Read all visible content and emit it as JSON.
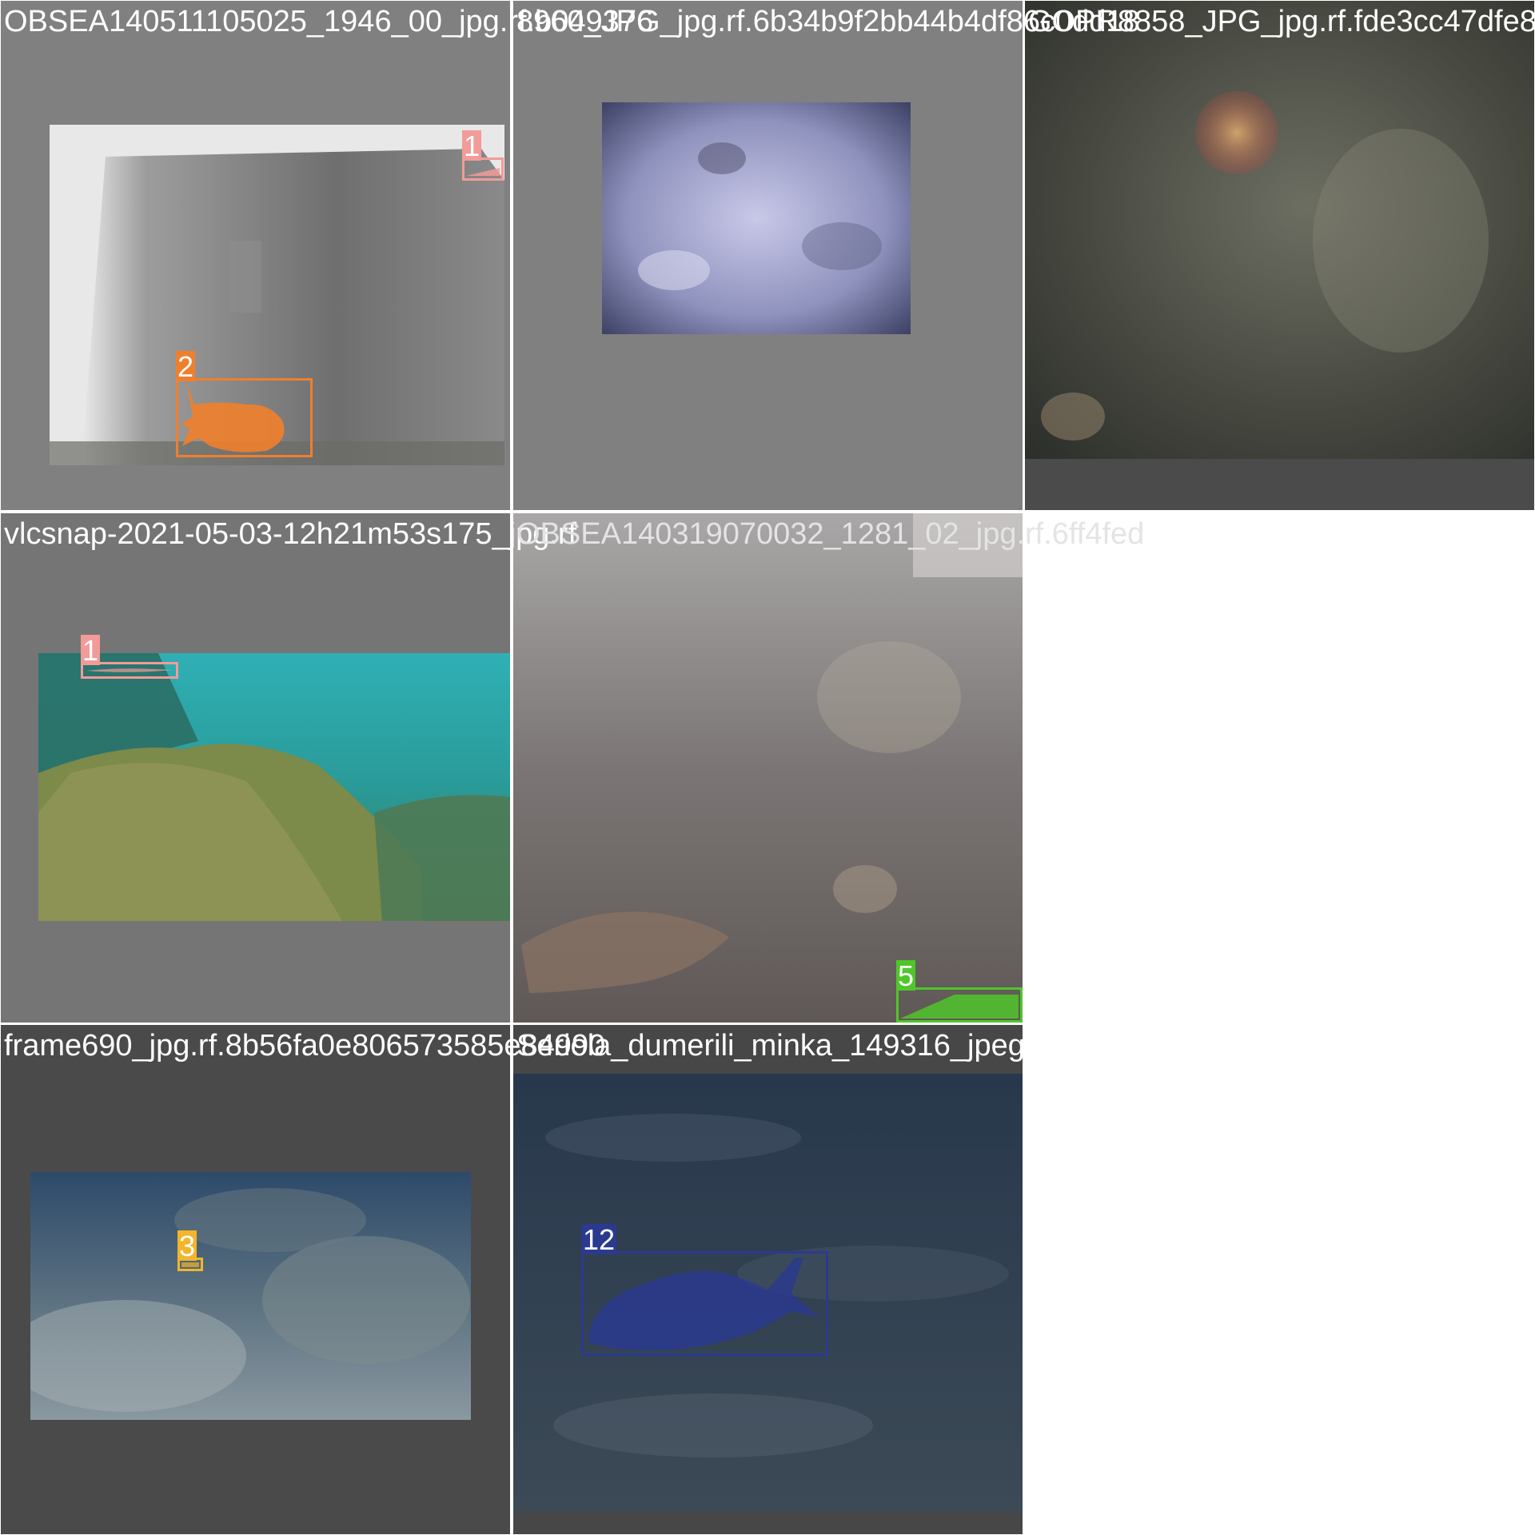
{
  "tiles": [
    {
      "caption": "OBSEA140511105025_1946_00_jpg.rf.b049376",
      "boxes": [
        {
          "label": "1",
          "color": "#f29b99"
        },
        {
          "label": "2",
          "color": "#f07f2c"
        }
      ]
    },
    {
      "caption": "8960_JPG_jpg.rf.6b34b9f2bb44b4df86c0dd18",
      "boxes": []
    },
    {
      "caption": "GOPR8858_JPG_jpg.rf.fde3cc47dfe8",
      "boxes": []
    },
    {
      "caption": "vlcsnap-2021-05-03-12h21m53s175_jpg.rf",
      "boxes": [
        {
          "label": "1",
          "color": "#f29b99"
        }
      ]
    },
    {
      "caption": "OBSEA140319070032_1281_02_jpg.rf.6ff4fed",
      "boxes": [
        {
          "label": "5",
          "color": "#4fc62a"
        }
      ]
    },
    {
      "caption": "frame690_jpg.rf.8b56fa0e806573585e84990",
      "boxes": [
        {
          "label": "3",
          "color": "#f3b52a"
        }
      ]
    },
    {
      "caption": "Seriola_dumerili_minka_149316_jpeg_jpg.r",
      "boxes": [
        {
          "label": "12",
          "color": "#2b3a8e"
        }
      ]
    }
  ]
}
